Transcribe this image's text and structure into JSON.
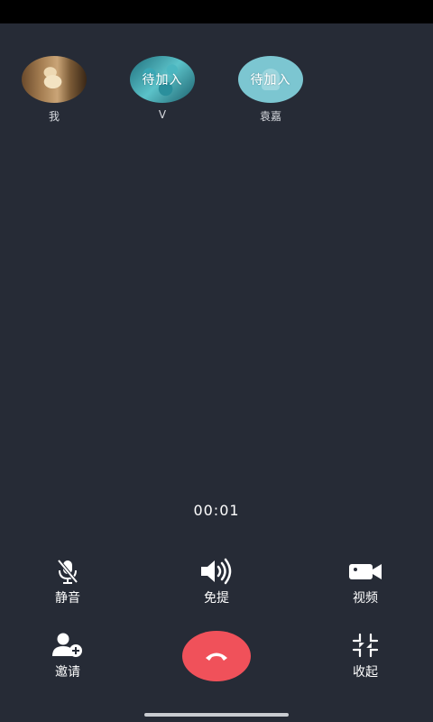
{
  "participants": [
    {
      "name": "我",
      "status": ""
    },
    {
      "name": "V",
      "status": "待加入"
    },
    {
      "name": "袁嘉",
      "status": "待加入"
    }
  ],
  "call": {
    "duration": "00:01"
  },
  "controls": {
    "mute": {
      "label": "静音",
      "icon": "mic-off-icon"
    },
    "speaker": {
      "label": "免提",
      "icon": "speaker-icon"
    },
    "video": {
      "label": "视频",
      "icon": "video-camera-icon"
    },
    "invite": {
      "label": "邀请",
      "icon": "add-user-icon"
    },
    "hangup": {
      "icon": "hang-up-icon",
      "color": "#f0515a"
    },
    "minimize": {
      "label": "收起",
      "icon": "minimize-icon"
    }
  },
  "theme": {
    "background": "#262b36",
    "accent": "#7cc6d1"
  }
}
